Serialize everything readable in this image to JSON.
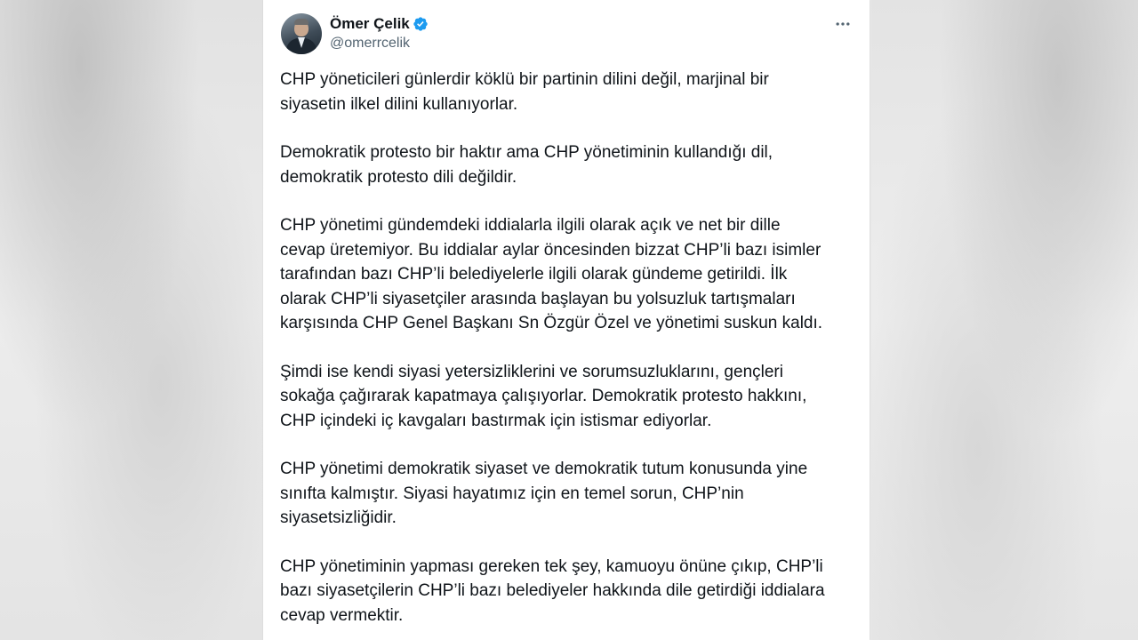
{
  "author": {
    "display_name": "Ömer Çelik",
    "handle": "@omerrcelik",
    "verified": true,
    "avatar_icon": "profile-photo"
  },
  "menu": {
    "icon": "more-horizontal-icon"
  },
  "colors": {
    "verified_blue": "#1d9bf0",
    "text_primary": "#0f1419",
    "text_secondary": "#536471"
  },
  "tweet": {
    "paragraphs": [
      "CHP yöneticileri günlerdir köklü bir partinin dilini değil, marjinal bir\nsiyasetin ilkel dilini kullanıyorlar.",
      "Demokratik protesto bir haktır ama CHP yönetiminin kullandığı dil,\ndemokratik protesto dili değildir.",
      "CHP yönetimi gündemdeki iddialarla ilgili olarak açık ve net bir dille\ncevap üretemiyor. Bu iddialar aylar öncesinden bizzat CHP’li bazı isimler\ntarafından bazı CHP’li belediyelerle ilgili olarak gündeme getirildi. İlk\nolarak CHP’li siyasetçiler arasında başlayan bu yolsuzluk tartışmaları\nkarşısında CHP Genel Başkanı Sn Özgür Özel ve yönetimi suskun kaldı.",
      "Şimdi ise kendi siyasi yetersizliklerini ve sorumsuzluklarını,  gençleri\nsokağa çağırarak kapatmaya çalışıyorlar. Demokratik protesto hakkını,\nCHP içindeki iç kavgaları bastırmak için istismar ediyorlar.",
      "CHP yönetimi demokratik siyaset ve demokratik tutum konusunda yine\nsınıfta kalmıştır. Siyasi hayatımız için en temel sorun, CHP’nin\nsiyasetsizliğidir.",
      "CHP yönetiminin yapması gereken tek şey, kamuoyu önüne çıkıp, CHP’li\nbazı siyasetçilerin CHP’li bazı belediyeler hakkında dile getirdiği iddialara\ncevap vermektir."
    ]
  }
}
